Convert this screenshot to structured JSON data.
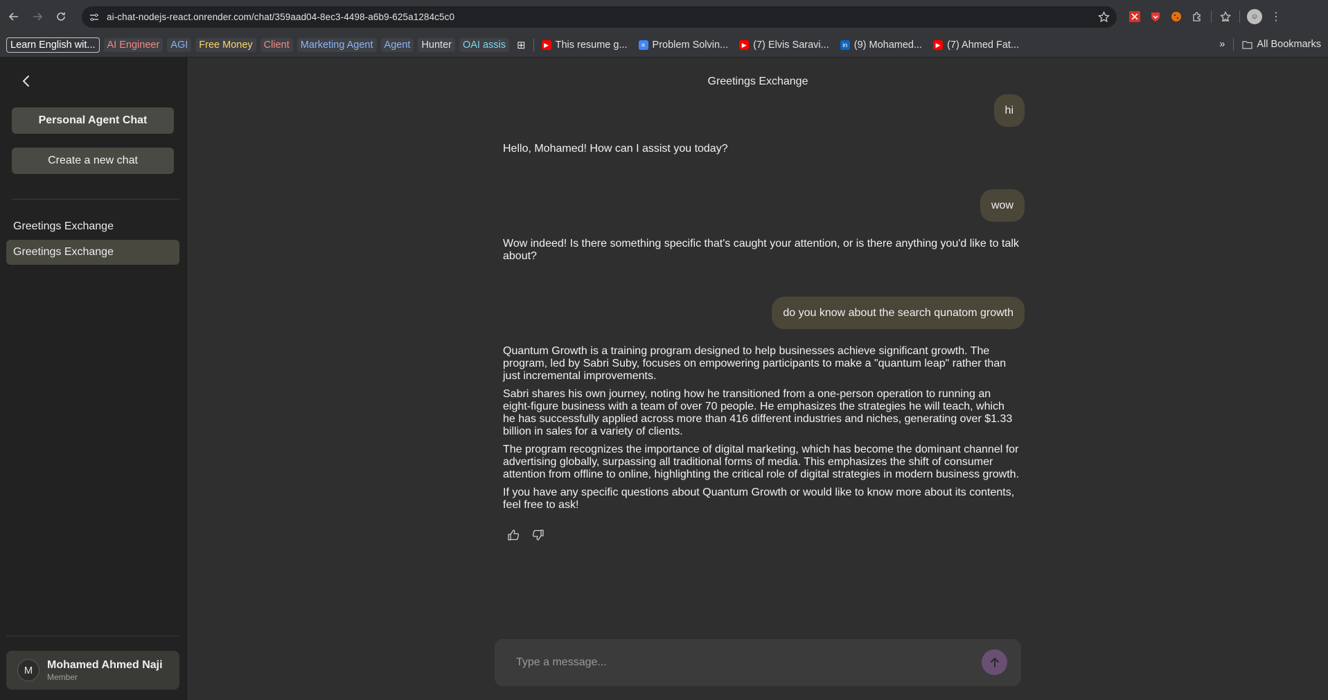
{
  "browser": {
    "url": "ai-chat-nodejs-react.onrender.com/chat/359aad04-8ec3-4498-a6b9-625a1284c5c0",
    "bookmarks": [
      {
        "label": "Learn English wit...",
        "style": "outline"
      },
      {
        "label": "AI Engineer",
        "color": "#f28b82"
      },
      {
        "label": "AGI",
        "color": "#8ab4f8"
      },
      {
        "label": "Free Money",
        "color": "#fdd663"
      },
      {
        "label": "Client",
        "color": "#f28b82"
      },
      {
        "label": "Marketing Agent",
        "color": "#8ab4f8"
      },
      {
        "label": "Agent",
        "color": "#8ab4f8"
      },
      {
        "label": "Hunter",
        "color": "#e3e3e3"
      },
      {
        "label": "OAI assis",
        "color": "#78d9ec"
      }
    ],
    "bookmark_links": [
      {
        "label": "This resume g...",
        "icon": "youtube-icon"
      },
      {
        "label": "Problem Solvin...",
        "icon": "docs-icon"
      },
      {
        "label": "(7) Elvis Saravi...",
        "icon": "youtube-icon"
      },
      {
        "label": "(9) Mohamed...",
        "icon": "linkedin-icon"
      },
      {
        "label": "(7) Ahmed Fat...",
        "icon": "youtube-icon"
      }
    ],
    "all_bookmarks": "All Bookmarks"
  },
  "sidebar": {
    "personal_agent_label": "Personal Agent Chat",
    "new_chat_label": "Create a new chat",
    "chats": [
      "Greetings Exchange",
      "Greetings Exchange"
    ],
    "user": {
      "initial": "M",
      "name": "Mohamed Ahmed Naji",
      "role": "Member"
    }
  },
  "chat": {
    "title": "Greetings Exchange",
    "messages": {
      "user_1": "hi",
      "assistant_1": "Hello, Mohamed! How can I assist you today?",
      "user_2": "wow",
      "assistant_2": "Wow indeed! Is there something specific that's caught your attention, or is there anything you'd like to talk about?",
      "user_3": "do you know about the search qunatom growth",
      "assistant_3": [
        "Quantum Growth is a training program designed to help businesses achieve significant growth. The program, led by Sabri Suby, focuses on empowering participants to make a \"quantum leap\" rather than just incremental improvements.",
        "Sabri shares his own journey, noting how he transitioned from a one-person operation to running an eight-figure business with a team of over 70 people. He emphasizes the strategies he will teach, which he has successfully applied across more than 416 different industries and niches, generating over $1.33 billion in sales for a variety of clients.",
        "The program recognizes the importance of digital marketing, which has become the dominant channel for advertising globally, surpassing all traditional forms of media. This emphasizes the shift of consumer attention from offline to online, highlighting the critical role of digital strategies in modern business growth.",
        "If you have any specific questions about Quantum Growth or would like to know more about its contents, feel free to ask!"
      ]
    },
    "composer_placeholder": "Type a message..."
  },
  "colors": {
    "user_bubble": "#4a4638",
    "send_button": "#6a4f74",
    "active_chat": "#48483f"
  }
}
